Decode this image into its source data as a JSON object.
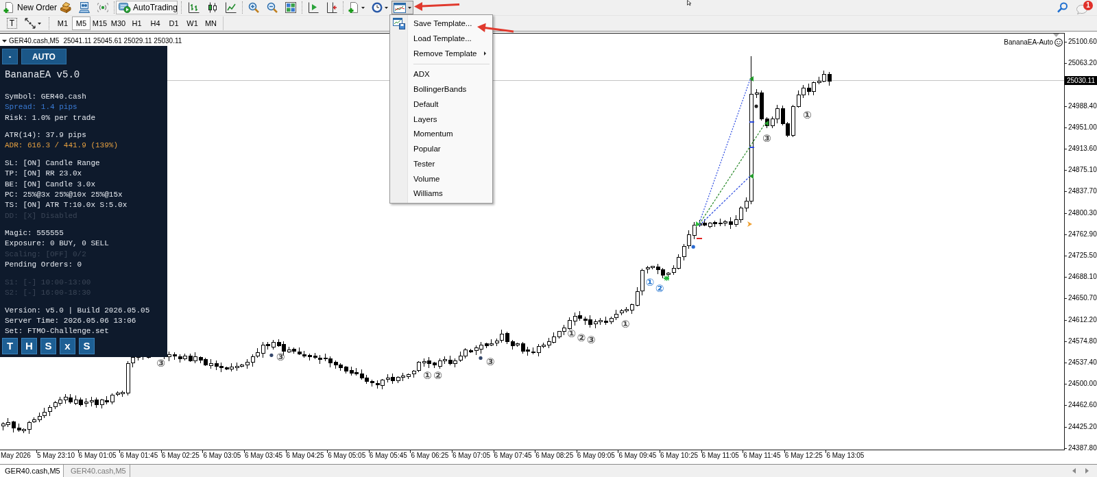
{
  "toolbar": {
    "new_order_button": "New Order",
    "autotrading_button": "AutoTrading",
    "template_button": {
      "expanded": true
    },
    "notification_badge": "1"
  },
  "timeframe_bar": {
    "text_tool": "T",
    "timeframes": [
      {
        "label": "M1",
        "selected": false
      },
      {
        "label": "M5",
        "selected": true
      },
      {
        "label": "M15",
        "selected": false
      },
      {
        "label": "M30",
        "selected": false
      },
      {
        "label": "H1",
        "selected": false
      },
      {
        "label": "H4",
        "selected": false
      },
      {
        "label": "D1",
        "selected": false
      },
      {
        "label": "W1",
        "selected": false
      },
      {
        "label": "MN",
        "selected": false
      }
    ]
  },
  "template_menu": {
    "actions": [
      {
        "label": "Save Template...",
        "kind": "icon"
      },
      {
        "label": "Load Template...",
        "kind": "plain"
      },
      {
        "label": "Remove Template",
        "kind": "submenu"
      }
    ],
    "templates": [
      "ADX",
      "BollingerBands",
      "Default",
      "Layers",
      "Momentum",
      "Popular",
      "Tester",
      "Volume",
      "Williams"
    ]
  },
  "chart": {
    "symbol": "GER40.cash,M5",
    "ohlc": "25041.11 25045.61 25029.11 25030.11",
    "expert_label": "BananaEA-Auto",
    "current_price": "25030.11",
    "price_labels": [
      "25100.60",
      "25063.20",
      "24988.40",
      "24951.00",
      "24913.60",
      "24875.10",
      "24837.70",
      "24800.30",
      "24762.90",
      "24725.50",
      "24688.10",
      "24650.70",
      "24612.20",
      "24574.80",
      "24537.40",
      "24500.00",
      "24462.60",
      "24425.20",
      "24387.80"
    ],
    "time_labels": [
      "May 2026",
      "5 May 23:10",
      "6 May 01:05",
      "6 May 01:45",
      "6 May 02:25",
      "6 May 03:05",
      "6 May 03:45",
      "6 May 04:25",
      "6 May 05:05",
      "6 May 05:45",
      "6 May 06:25",
      "6 May 07:05",
      "6 May 07:45",
      "6 May 08:25",
      "6 May 09:05",
      "6 May 09:45",
      "6 May 10:25",
      "6 May 11:05",
      "6 May 11:45",
      "6 May 12:25",
      "6 May 13:05"
    ],
    "markers": [
      {
        "label": "③",
        "color": "#4a4a4a"
      },
      {
        "label": "③",
        "color": "#4a4a4a"
      },
      {
        "label": "①",
        "color": "#4a4a4a"
      },
      {
        "label": "②",
        "color": "#4a4a4a"
      },
      {
        "label": "③",
        "color": "#4a4a4a"
      },
      {
        "label": "①",
        "color": "#4a4a4a"
      },
      {
        "label": "②",
        "color": "#4a4a4a"
      },
      {
        "label": "③",
        "color": "#4a4a4a"
      },
      {
        "label": "①",
        "color": "#4a4a4a"
      },
      {
        "label": "①",
        "color": "#2a78d0"
      },
      {
        "label": "②",
        "color": "#2a78d0"
      },
      {
        "label": "③",
        "color": "#4a4a4a"
      },
      {
        "label": "①",
        "color": "#4a4a4a"
      }
    ]
  },
  "ea_panel": {
    "buttons": [
      "-",
      "AUTO"
    ],
    "title": "BananaEA v5.0",
    "sections": [
      {
        "lines": [
          {
            "text": "Symbol: GER40.cash",
            "color": "#e6eaf0"
          },
          {
            "text": "Spread: 1.4 pips",
            "color": "#3a7bd5"
          },
          {
            "text": "Risk: 1.0% per trade",
            "color": "#e6eaf0"
          }
        ]
      },
      {
        "lines": [
          {
            "text": "ATR(14): 37.9 pips",
            "color": "#e6eaf0"
          },
          {
            "text": "ADR: 616.3 / 441.9 (139%)",
            "color": "#e5a040"
          }
        ]
      },
      {
        "lines": [
          {
            "text": "SL: [ON] Candle Range",
            "color": "#e6eaf0"
          },
          {
            "text": "TP: [ON] RR 23.0x",
            "color": "#e6eaf0"
          },
          {
            "text": "BE: [ON] Candle 3.0x",
            "color": "#e6eaf0"
          },
          {
            "text": "PC: 25%@3x 25%@10x 25%@15x",
            "color": "#e6eaf0"
          },
          {
            "text": "TS: [ON] ATR T:10.0x S:5.0x",
            "color": "#e6eaf0"
          },
          {
            "text": "DD: [X] Disabled",
            "color": "#3b4657"
          }
        ]
      },
      {
        "lines": [
          {
            "text": "Magic: 555555",
            "color": "#e6eaf0"
          },
          {
            "text": "Exposure: 0 BUY, 0 SELL",
            "color": "#e6eaf0"
          },
          {
            "text": "Scaling: [OFF] 0/2",
            "color": "#3b4657"
          },
          {
            "text": "Pending Orders: 0",
            "color": "#e6eaf0"
          }
        ]
      },
      {
        "lines": [
          {
            "text": "S1: [-] 10:00-13:00",
            "color": "#3b4657"
          },
          {
            "text": "S2: [-] 16:00-18:30",
            "color": "#3b4657"
          }
        ]
      },
      {
        "lines": [
          {
            "text": "Version: v5.0 | Build 2026.05.05",
            "color": "#e6eaf0"
          },
          {
            "text": "Server Time: 2026.05.06 13:06",
            "color": "#e6eaf0"
          },
          {
            "text": "Set: FTMO-Challenge.set",
            "color": "#e6eaf0"
          }
        ]
      }
    ],
    "footer_buttons": [
      "T",
      "H",
      "S",
      "x",
      "S"
    ]
  },
  "tabs": [
    {
      "label": "GER40.cash,M5",
      "selected": true
    },
    {
      "label": "GER40.cash,M5",
      "selected": false
    }
  ]
}
